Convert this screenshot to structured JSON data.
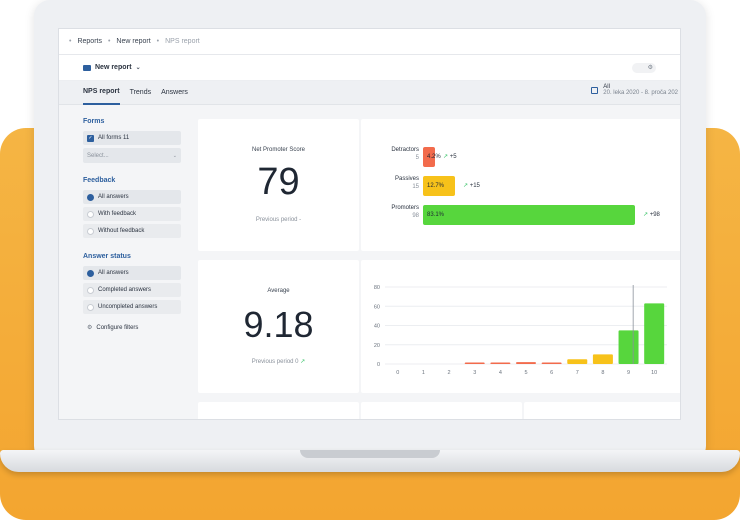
{
  "colors": {
    "accent": "#2d5f9e",
    "detractors": "#f26b4c",
    "passives": "#f7c21a",
    "promoters": "#57d63d",
    "trend": "#3cc46b"
  },
  "breadcrumb": [
    "Reports",
    "New report",
    "NPS report"
  ],
  "report": {
    "title": "New report"
  },
  "tabs": [
    "NPS report",
    "Trends",
    "Answers"
  ],
  "date_filter": {
    "label": "All",
    "range": "20. leka 2020 - 8. proča 202"
  },
  "sidebar": {
    "forms": {
      "title": "Forms",
      "all_forms": "All forms 11",
      "select_placeholder": "Select..."
    },
    "feedback": {
      "title": "Feedback",
      "options": [
        "All answers",
        "With feedback",
        "Without feedback"
      ],
      "selected": 0
    },
    "answer_status": {
      "title": "Answer status",
      "options": [
        "All answers",
        "Completed answers",
        "Uncompleted answers"
      ],
      "selected": 0
    },
    "configure": "Configure filters"
  },
  "nps": {
    "label": "Net Promoter Score",
    "value": "79",
    "previous": "Previous period -"
  },
  "distribution": [
    {
      "name": "Detractors",
      "count": "5",
      "percent_label": "4.2%",
      "fraction": 0.042,
      "delta": "+5"
    },
    {
      "name": "Passives",
      "count": "15",
      "percent_label": "12.7%",
      "fraction": 0.127,
      "delta": "+15"
    },
    {
      "name": "Promoters",
      "count": "98",
      "percent_label": "83.1%",
      "fraction": 0.831,
      "delta": "+98"
    }
  ],
  "average": {
    "label": "Average",
    "value": "9.18",
    "previous": "Previous period 0"
  },
  "chart_data": {
    "type": "bar",
    "categories": [
      "0",
      "1",
      "2",
      "3",
      "4",
      "5",
      "6",
      "7",
      "8",
      "9",
      "10"
    ],
    "values": [
      0,
      0,
      0,
      1,
      1,
      2,
      1,
      5,
      10,
      35,
      63
    ],
    "ylim": [
      0,
      80
    ],
    "yticks": [
      0,
      20,
      40,
      60,
      80
    ],
    "grid": true,
    "mean_marker": 9.18
  }
}
